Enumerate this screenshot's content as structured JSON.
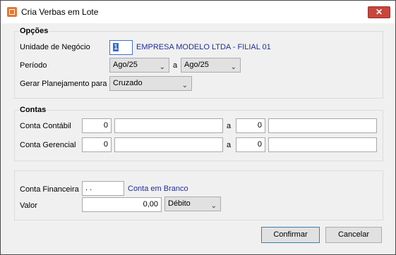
{
  "window": {
    "title": "Cria Verbas em Lote",
    "close_label": "✕"
  },
  "opcoes": {
    "group_label": "Opções",
    "unidade_label": "Unidade de Negócio",
    "unidade_value": "1",
    "unidade_desc": "EMPRESA MODELO LTDA - FILIAL 01",
    "periodo_label": "Período",
    "periodo_from": "Ago/25",
    "periodo_sep": "a",
    "periodo_to": "Ago/25",
    "planejamento_label": "Gerar Planejamento para",
    "planejamento_value": "Cruzado"
  },
  "contas": {
    "group_label": "Contas",
    "contabil_label": "Conta Contábil",
    "contabil_from": "0",
    "contabil_from_desc": "",
    "contabil_sep": "a",
    "contabil_to": "0",
    "contabil_to_desc": "",
    "gerencial_label": "Conta Gerencial",
    "gerencial_from": "0",
    "gerencial_from_desc": "",
    "gerencial_sep": "a",
    "gerencial_to": "0",
    "gerencial_to_desc": ""
  },
  "financeiro": {
    "conta_label": "Conta Financeira",
    "conta_value": ". .",
    "conta_desc": "Conta em Branco",
    "valor_label": "Valor",
    "valor_value": "0,00",
    "tipo_value": "Débito"
  },
  "buttons": {
    "confirmar": "Confirmar",
    "cancelar": "Cancelar"
  },
  "icons": {
    "app": "app-icon",
    "dropdown": "chevron-down-icon"
  }
}
